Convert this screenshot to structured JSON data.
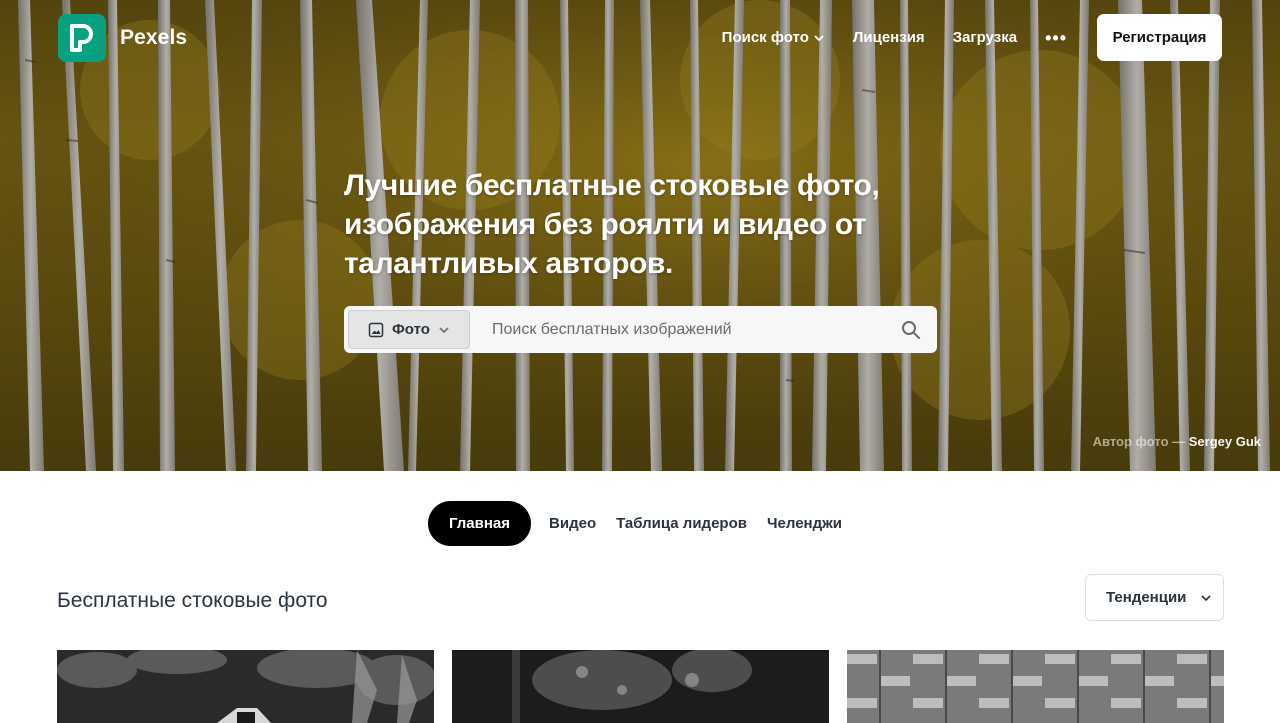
{
  "brand": {
    "name": "Pexels",
    "accent": "#07a081"
  },
  "nav": {
    "items": [
      {
        "label": "Поиск фото",
        "has_chevron": true
      },
      {
        "label": "Лицензия"
      },
      {
        "label": "Загрузка"
      }
    ],
    "more_label": "•••",
    "register_label": "Регистрация"
  },
  "hero": {
    "title": "Лучшие бесплатные стоковые фото, изображения без роялти и видео от талантливых авторов.",
    "search": {
      "type_label": "Фото",
      "type_icon": "image-icon",
      "placeholder": "Поиск бесплатных изображений",
      "search_icon": "magnifier-icon"
    },
    "credit_prefix": "Автор фото — ",
    "credit_author": "Sergey Guk"
  },
  "tabs": [
    {
      "label": "Главная",
      "active": true
    },
    {
      "label": "Видео"
    },
    {
      "label": "Таблица лидеров"
    },
    {
      "label": "Челенджи"
    }
  ],
  "section": {
    "title": "Бесплатные стоковые фото",
    "sort_label": "Тенденции"
  }
}
